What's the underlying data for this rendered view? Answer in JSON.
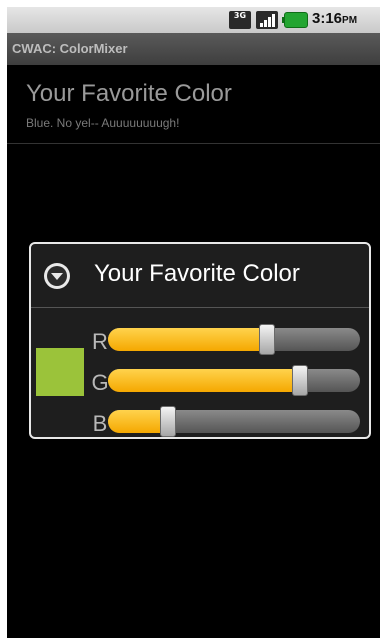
{
  "status_bar": {
    "network_icon": "3g-icon",
    "network_text": "3G",
    "signal_icon": "signal-bars-icon",
    "battery_icon": "battery-charging-icon",
    "time": "3:16",
    "ampm": "PM"
  },
  "app_title": "CWAC: ColorMixer",
  "preference": {
    "title": "Your Favorite Color",
    "summary": "Blue.  No yel-- Auuuuuuuugh!"
  },
  "dialog": {
    "icon": "dropdown-arrow-icon",
    "title": "Your Favorite Color",
    "swatch_color": "#9bc33a",
    "sliders": [
      {
        "label": "R",
        "value": 0.63
      },
      {
        "label": "G",
        "value": 0.76
      },
      {
        "label": "B",
        "value": 0.24
      }
    ]
  },
  "colors": {
    "accent": "#f5a800",
    "background": "#000000"
  }
}
